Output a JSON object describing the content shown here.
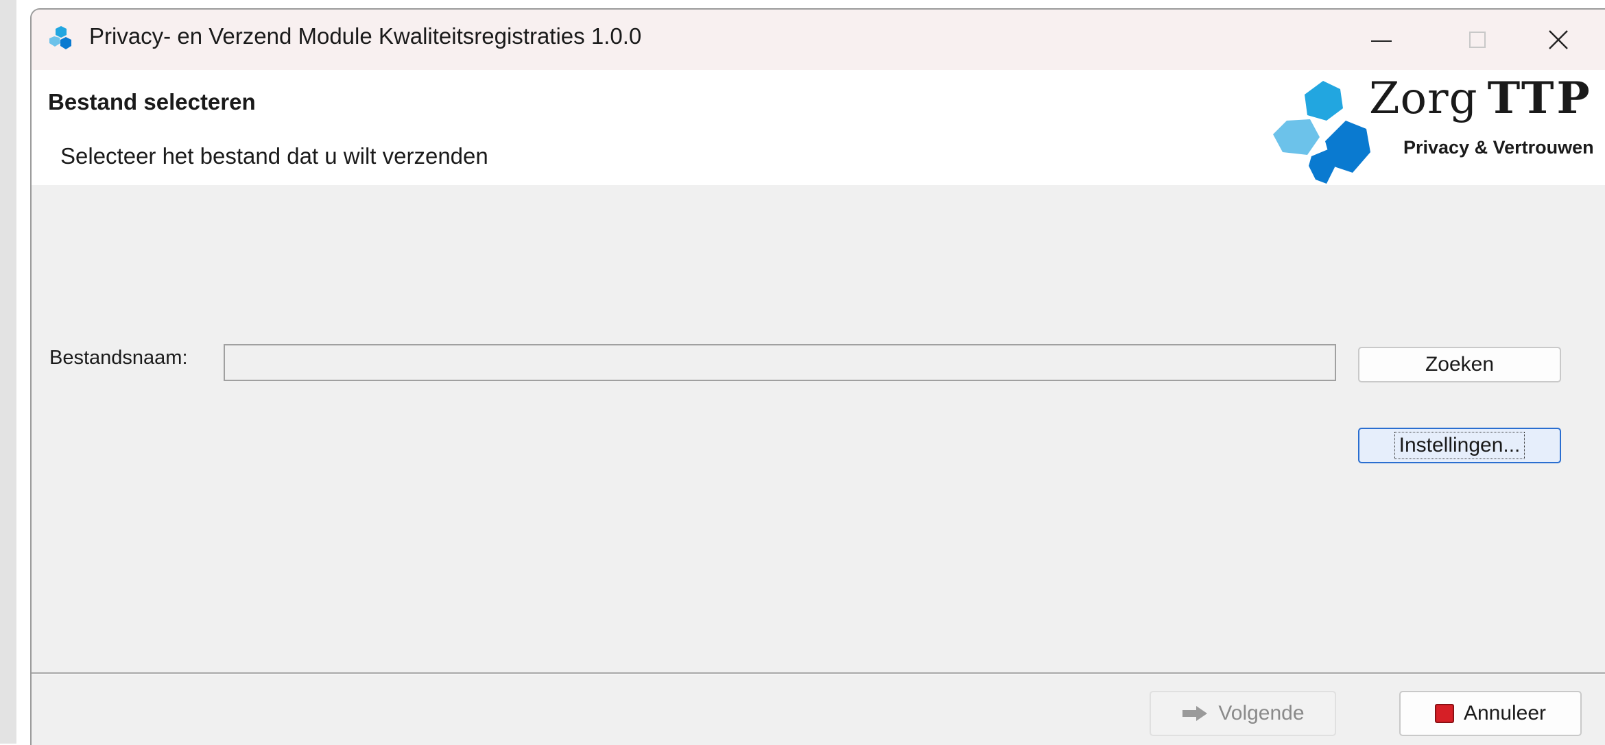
{
  "window": {
    "title": "Privacy- en Verzend Module Kwaliteitsregistraties 1.0.0",
    "app_icon": "zorgttp-logo-icon",
    "controls": {
      "minimize": "minimize-icon",
      "maximize": "maximize-icon",
      "close": "close-icon"
    }
  },
  "header": {
    "step_title": "Bestand selecteren",
    "step_description": "Selecteer het bestand dat u wilt verzenden",
    "logo": {
      "word": "Zorg",
      "word_bold": "TTP",
      "tagline": "Privacy & Vertrouwen"
    }
  },
  "form": {
    "filename_label": "Bestandsnaam:",
    "filename_value": "",
    "search_label": "Zoeken",
    "settings_label": "Instellingen..."
  },
  "footer": {
    "next_label": "Volgende",
    "next_icon": "arrow-right-icon",
    "cancel_label": "Annuleer",
    "cancel_icon": "stop-square-icon"
  },
  "colors": {
    "accent": "#2a6ed0",
    "logo_dark_blue": "#0a7ad0",
    "logo_mid_blue": "#22a6e0",
    "logo_light_blue": "#6cc2ea",
    "cancel_red": "#d61f26"
  }
}
